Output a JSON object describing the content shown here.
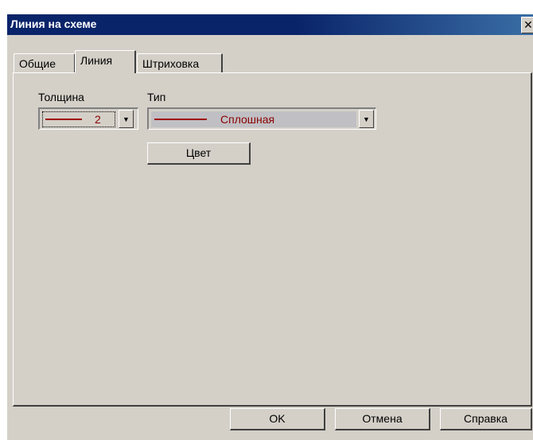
{
  "window": {
    "title": "Линия на схеме",
    "close_label": "✕"
  },
  "tabs": [
    {
      "label": "Общие"
    },
    {
      "label": "Линия"
    },
    {
      "label": "Штриховка"
    }
  ],
  "line_tab": {
    "thickness_label": "Толщина",
    "thickness_value": "2",
    "type_label": "Тип",
    "type_value": "Сплошная",
    "color_button": "Цвет"
  },
  "buttons": {
    "ok": "OK",
    "cancel": "Отмена",
    "help": "Справка"
  },
  "colors": {
    "titlebar": "#0a246a",
    "face": "#d4d0c8",
    "line_sample": "#a00000"
  },
  "icons": {
    "dropdown": "chevron-down-icon",
    "close": "close-icon"
  }
}
